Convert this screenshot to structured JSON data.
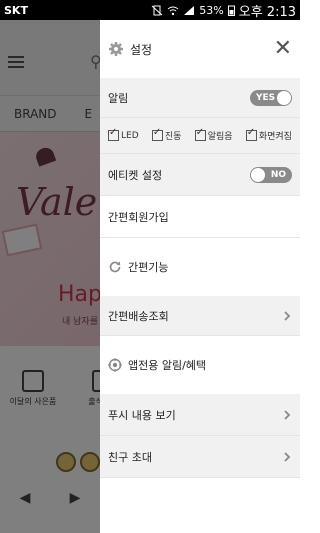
{
  "status_bar": {
    "carrier": "SKT",
    "battery": "53%",
    "time": "오후 2:13"
  },
  "background": {
    "nav_items": [
      "BRAND",
      "E"
    ],
    "banner_text": "Valen",
    "banner_happy": "Happ",
    "banner_sub": "내 남자를",
    "icon_labels": [
      "이달의 사은품",
      "출석체크"
    ]
  },
  "drawer": {
    "title": "설정",
    "alarm": {
      "label": "알림",
      "toggle": "YES"
    },
    "alarm_options": [
      "LED",
      "진동",
      "알림음",
      "화면켜짐"
    ],
    "etiquette": {
      "label": "에티켓 설정",
      "toggle": "NO"
    },
    "easy_join": "간편회원가입",
    "easy_function": "간편기능",
    "easy_delivery": "간편배송조회",
    "app_alarm": "앱전용 알림/혜택",
    "push_view": "푸시 내용 보기",
    "invite": "친구 초대"
  },
  "colors": {
    "toggle_bg": "#8a8a8a",
    "grey_row": "#f1f1f1",
    "scrim": "rgba(0,0,0,0.5)"
  }
}
